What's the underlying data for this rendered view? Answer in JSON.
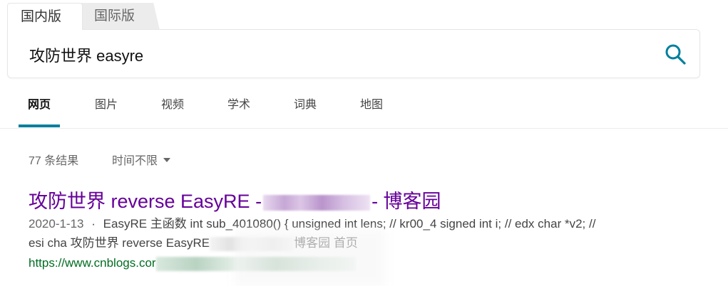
{
  "region_tabs": [
    {
      "label": "国内版",
      "active": true
    },
    {
      "label": "国际版",
      "active": false
    }
  ],
  "search": {
    "value": "攻防世界 easyre",
    "icon": "search-icon",
    "accent": "#00809d"
  },
  "nav": {
    "items": [
      {
        "label": "网页",
        "active": true
      },
      {
        "label": "图片",
        "active": false
      },
      {
        "label": "视频",
        "active": false
      },
      {
        "label": "学术",
        "active": false
      },
      {
        "label": "词典",
        "active": false
      },
      {
        "label": "地图",
        "active": false
      }
    ]
  },
  "results_meta": {
    "count": "77 条结果",
    "time_filter": "时间不限"
  },
  "result": {
    "title_prefix": "攻防世界 reverse EasyRE -",
    "title_suffix": "- 博客园",
    "date": "2020-1-13",
    "separator": "·",
    "snippet_line1": "EasyRE 主函数 int sub_401080() { unsigned int lens; // kr00_4 signed int i; // edx char *v2; //",
    "snippet_line2a": "esi cha 攻防世界 reverse EasyRE",
    "snippet_line2b": "博客园 首页",
    "url_prefix": "https://www.cnblogs.cor",
    "title_color": "#660099",
    "url_color": "#006d21"
  }
}
